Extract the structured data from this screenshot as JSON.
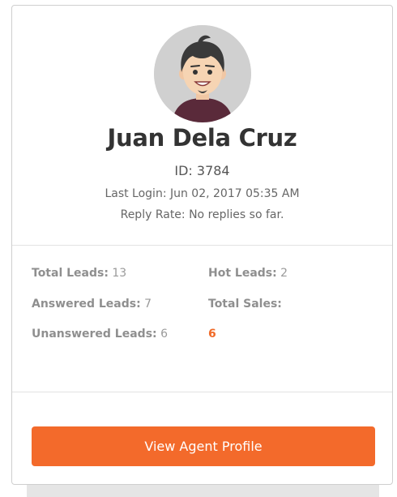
{
  "agent": {
    "name": "Juan Dela Cruz",
    "id_text": "ID: 3784",
    "last_login": "Last Login: Jun 02, 2017  05:35 AM",
    "reply_rate": "Reply Rate: No replies so far."
  },
  "stats": {
    "total_leads": {
      "label": "Total Leads:",
      "value": "13"
    },
    "hot_leads": {
      "label": "Hot Leads:",
      "value": "2"
    },
    "answered_leads": {
      "label": "Answered Leads:",
      "value": "7"
    },
    "total_sales": {
      "label": "Total Sales:",
      "value": "6"
    },
    "unanswered_leads": {
      "label": "Unanswered Leads:",
      "value": "6"
    }
  },
  "actions": {
    "view_profile_label": "View Agent Profile"
  },
  "colors": {
    "accent": "#f36a2b",
    "highlight": "#f06a28",
    "avatar_bg": "#cfcfcf"
  },
  "icons": {
    "avatar": "cartoon-man-avatar"
  }
}
